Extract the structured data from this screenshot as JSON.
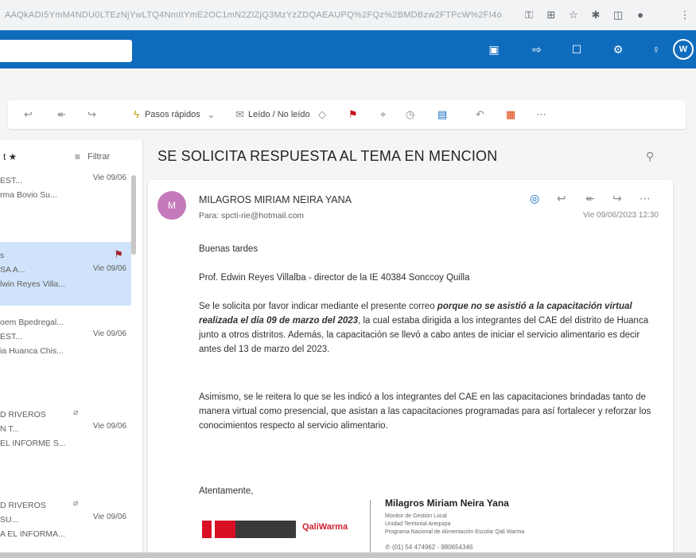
{
  "browser": {
    "url": "AAQkADI5YmM4NDU0LTEzNjYwLTQ4NmItYmE2OC1mN2ZlZjQ3MzYzZDQAEAUPQ%2FQz%2BMDBzw2FTPcW%2FI4o",
    "icons": [
      "key-icon",
      "translate-icon",
      "star-icon",
      "extensions-icon",
      "split-icon",
      "profile-icon",
      "more-icon"
    ]
  },
  "topbar": {
    "search_value": "",
    "icons": [
      "meet-icon",
      "teams-icon",
      "notes-icon",
      "settings-icon",
      "tips-icon"
    ],
    "avatar_initial": "W"
  },
  "toolbar": {
    "quick_steps": "Pasos rápidos",
    "read_unread": "Leído / No leído"
  },
  "list": {
    "filter_label": "Filtrar",
    "items": [
      {
        "line1": "EST...",
        "date": "Vie 09/06",
        "line2": "rma Bovio Su..."
      },
      {
        "line1": "s",
        "line1b": "SA A...",
        "date": "Vie 09/06",
        "line2": "lwin Reyes Villa..."
      },
      {
        "line1": "oem Bpedregal...",
        "line1b": "EST...",
        "date": "Vie 09/06",
        "line2": "ia Huanca Chis..."
      },
      {
        "line1": "D RIVEROS",
        "line1b": "N T...",
        "date": "Vie 09/06",
        "line2": "EL INFORME S..."
      },
      {
        "line1": "D RIVEROS",
        "line1b": "SU...",
        "date": "Vie 09/06",
        "line2": "A EL INFORMA..."
      }
    ]
  },
  "message": {
    "subject": "SE SOLICITA RESPUESTA AL TEMA EN MENCION",
    "sender_initial": "M",
    "sender_name": "MILAGROS MIRIAM NEIRA YANA",
    "to": "Para: spcti-rie@hotmail.com",
    "date": "Vie 09/06/2023 12:30",
    "greeting": "Buenas tardes",
    "addressee": "Prof. Edwin Reyes Villalba - director de la IE 40384 Sonccoy Quilla",
    "p1_a": "Se le solicita por favor indicar mediante el presente correo ",
    "p1_b": "porque no se asistió a la capacitación virtual realizada el día 09 de marzo del 2023",
    "p1_c": ", la cual estaba dirigida a los integrantes del CAE del distrito de Huanca junto a otros distritos.  Además, la capacitación se llevó a cabo antes de iniciar el servicio alimentario es decir antes del 13 de marzo del 2023.",
    "p2": "Asimismo, se le reitera lo que se les indicó a los integrantes del CAE en las capacitaciones brindadas tanto de manera virtual como presencial, que asistan a las capacitaciones programadas para así fortalecer y reforzar los conocimientos respecto al servicio alimentario.",
    "closing": "Atentamente,"
  },
  "signature": {
    "name": "Milagros Miriam Neira Yana",
    "line1": "Monitor de Gestión Local",
    "line2": "Unidad Territorial Arequipa",
    "line3": "Programa Nacional de Alimentación Escolar Qali Warma",
    "phone": "(01) 54 474962 - 980654346",
    "logo_text": "QaliWarma"
  },
  "colors": {
    "brand": "#0f6cbd",
    "avatar": "#c47aba",
    "flag": "#a4262c"
  }
}
